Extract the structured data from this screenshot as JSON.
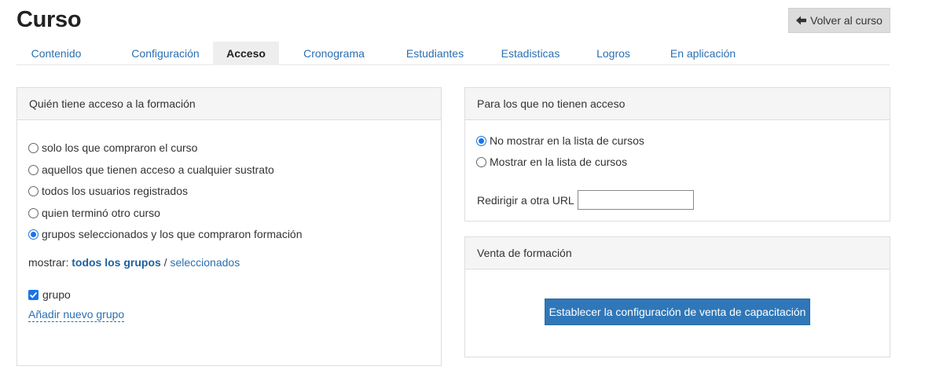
{
  "page": {
    "title": "Curso"
  },
  "header": {
    "back_label": "Volver al curso",
    "back_icon": "arrow-left-icon"
  },
  "tabs": [
    {
      "label": "Contenido",
      "active": false
    },
    {
      "label": "Configuración",
      "active": false
    },
    {
      "label": "Acceso",
      "active": true
    },
    {
      "label": "Cronograma",
      "active": false
    },
    {
      "label": "Estudiantes",
      "active": false
    },
    {
      "label": "Estadisticas",
      "active": false
    },
    {
      "label": "Logros",
      "active": false
    },
    {
      "label": "En aplicación",
      "active": false
    }
  ],
  "access_panel": {
    "title": "Quién tiene acceso a la formación",
    "options": [
      {
        "label": "solo los que compraron el curso",
        "checked": false
      },
      {
        "label": "aquellos que tienen acceso a cualquier sustrato",
        "checked": false
      },
      {
        "label": "todos los usuarios registrados",
        "checked": false
      },
      {
        "label": "quien terminó otro curso",
        "checked": false
      },
      {
        "label": "grupos seleccionados y los que compraron formación",
        "checked": true
      }
    ],
    "show_label": "mostrar:",
    "show_all": "todos los grupos",
    "show_separator": " / ",
    "show_selected": "seleccionados",
    "group_label": "grupo",
    "group_checked": true,
    "add_group": "Añadir nuevo grupo"
  },
  "no_access_panel": {
    "title": "Para los que no tienen acceso",
    "options": [
      {
        "label": "No mostrar en la lista de cursos",
        "checked": true
      },
      {
        "label": "Mostrar en la lista de cursos",
        "checked": false
      }
    ],
    "redirect_label": "Redirigir a otra URL",
    "redirect_value": ""
  },
  "sale_panel": {
    "title": "Venta de formación",
    "button_label": "Establecer la configuración de venta de capacitación"
  },
  "colors": {
    "accent": "#2f77b8",
    "link": "#2a6fb1",
    "radio_checked": "#1a73e8"
  }
}
